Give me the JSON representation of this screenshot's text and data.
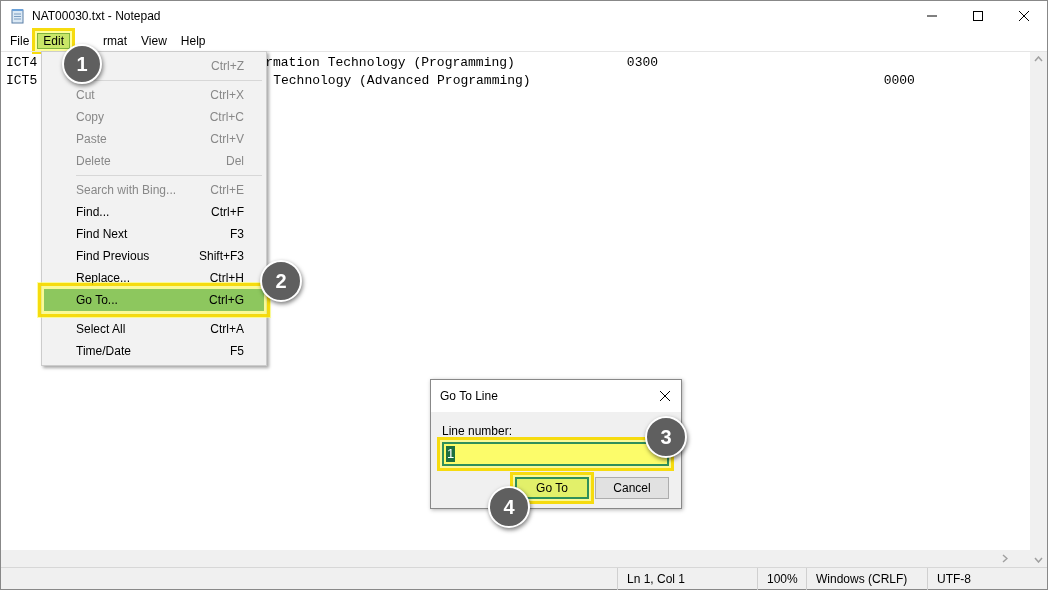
{
  "window": {
    "title": "NAT00030.txt - Notepad"
  },
  "menu_bar": [
    {
      "label": "File",
      "selected": false,
      "highlighted": false
    },
    {
      "label": "Edit",
      "selected": true,
      "highlighted": true
    },
    {
      "label": "rmat",
      "selected": false,
      "highlighted": false
    },
    {
      "label": "View",
      "selected": false,
      "highlighted": false
    },
    {
      "label": "Help",
      "selected": false,
      "highlighted": false
    }
  ],
  "editor_lines": [
    {
      "start": "ICT4",
      "rest": "rmation Technology (Programming)",
      "code": "0300"
    },
    {
      "start": "ICT5",
      "rest": "Technology (Advanced Programming)",
      "code": "0000"
    }
  ],
  "edit_menu": [
    {
      "kind": "item",
      "shortcut": "Ctrl+Z",
      "disabled": true,
      "selected": false,
      "highlighted": false
    },
    {
      "kind": "separator"
    },
    {
      "kind": "item",
      "label": "Cut",
      "shortcut": "Ctrl+X",
      "disabled": true,
      "selected": false,
      "highlighted": false
    },
    {
      "kind": "item",
      "label": "Copy",
      "shortcut": "Ctrl+C",
      "disabled": true,
      "selected": false,
      "highlighted": false
    },
    {
      "kind": "item",
      "label": "Paste",
      "shortcut": "Ctrl+V",
      "disabled": true,
      "selected": false,
      "highlighted": false
    },
    {
      "kind": "item",
      "label": "Delete",
      "shortcut": "Del",
      "disabled": true,
      "selected": false,
      "highlighted": false
    },
    {
      "kind": "separator"
    },
    {
      "kind": "item",
      "label": "Search with Bing...",
      "shortcut": "Ctrl+E",
      "disabled": true,
      "selected": false,
      "highlighted": false
    },
    {
      "kind": "item",
      "label": "Find...",
      "shortcut": "Ctrl+F",
      "disabled": false,
      "selected": false,
      "highlighted": false
    },
    {
      "kind": "item",
      "label": "Find Next",
      "shortcut": "F3",
      "disabled": false,
      "selected": false,
      "highlighted": false
    },
    {
      "kind": "item",
      "label": "Find Previous",
      "shortcut": "Shift+F3",
      "disabled": false,
      "selected": false,
      "highlighted": false
    },
    {
      "kind": "item",
      "label": "Replace...",
      "shortcut": "Ctrl+H",
      "disabled": false,
      "selected": false,
      "highlighted": false
    },
    {
      "kind": "item",
      "label": "Go To...",
      "shortcut": "Ctrl+G",
      "disabled": false,
      "selected": true,
      "highlighted": true
    },
    {
      "kind": "separator"
    },
    {
      "kind": "item",
      "label": "Select All",
      "shortcut": "Ctrl+A",
      "disabled": false,
      "selected": false,
      "highlighted": false
    },
    {
      "kind": "item",
      "label": "Time/Date",
      "shortcut": "F5",
      "disabled": false,
      "selected": false,
      "highlighted": false
    }
  ],
  "dialog": {
    "title": "Go To Line",
    "field_label": "Line number:",
    "value": "1",
    "field_highlighted": true,
    "buttons": [
      {
        "label": "Go To",
        "default": true,
        "highlighted": true
      },
      {
        "label": "Cancel",
        "default": false,
        "highlighted": false
      }
    ]
  },
  "callouts": [
    {
      "number": "1"
    },
    {
      "number": "2"
    },
    {
      "number": "3"
    },
    {
      "number": "4"
    }
  ],
  "status_bar": [
    "Ln 1, Col 1",
    "100%",
    "Windows (CRLF)",
    "UTF-8"
  ]
}
